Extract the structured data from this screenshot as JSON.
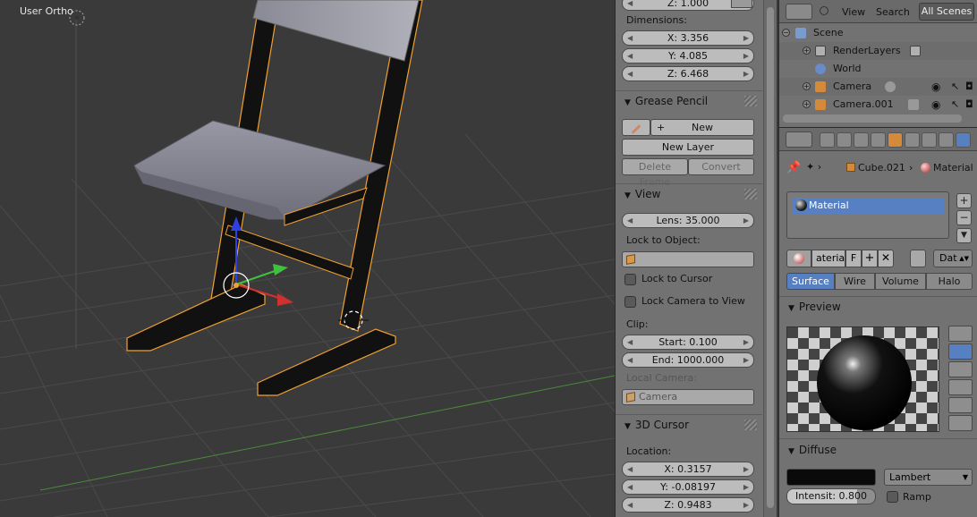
{
  "viewport": {
    "title": "User Ortho"
  },
  "npanel": {
    "scale_z_partial": "Z: 1.000",
    "dimensions_label": "Dimensions:",
    "dimensions": {
      "x": "X: 3.356",
      "y": "Y: 4.085",
      "z": "Z: 6.468"
    },
    "grease_pencil": {
      "header": "Grease Pencil",
      "new_label": "New",
      "new_layer_label": "New Layer",
      "delete_frame_label": "Delete Frame",
      "convert_label": "Convert"
    },
    "view": {
      "header": "View",
      "lens": "Lens: 35.000",
      "lock_to_object_label": "Lock to Object:",
      "lock_to_cursor_label": "Lock to Cursor",
      "lock_camera_label": "Lock Camera to View",
      "clip_label": "Clip:",
      "clip_start": "Start: 0.100",
      "clip_end": "End: 1000.000",
      "local_camera_label": "Local Camera:",
      "local_camera_value": "Camera"
    },
    "cursor": {
      "header": "3D Cursor",
      "location_label": "Location:",
      "x": "X: 0.3157",
      "y": "Y: -0.08197",
      "z": "Z: 0.9483"
    }
  },
  "outliner": {
    "header": {
      "view_label": "View",
      "search_label": "Search",
      "scenes_label": "All Scenes"
    },
    "rows": [
      {
        "label": "Scene"
      },
      {
        "label": "RenderLayers"
      },
      {
        "label": "World"
      },
      {
        "label": "Camera"
      },
      {
        "label": "Camera.001"
      }
    ]
  },
  "properties": {
    "breadcrumb": {
      "object": "Cube.021",
      "material": "Material"
    },
    "material_slot": "Material",
    "datablock_name": "aterial",
    "fake_user": "F",
    "link_mode": "Dat",
    "tabs": [
      "Surface",
      "Wire",
      "Volume",
      "Halo"
    ],
    "active_tab": "Surface",
    "preview_header": "Preview",
    "diffuse": {
      "header": "Diffuse",
      "shader": "Lambert",
      "intensity": "Intensit: 0.800",
      "intensity_value": 0.8,
      "ramp_label": "Ramp",
      "color": "#0a0a0a"
    }
  },
  "colors": {
    "accent": "#5680c2",
    "selection_outline": "#f0a030",
    "axis_x": "#d03030",
    "axis_y": "#40c040",
    "axis_z": "#3040e0"
  }
}
